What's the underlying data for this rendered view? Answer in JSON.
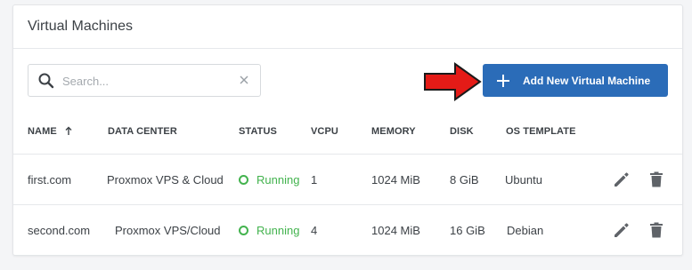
{
  "title": "Virtual Machines",
  "search": {
    "placeholder": "Search...",
    "value": ""
  },
  "add_button_label": "Add New Virtual Machine",
  "columns": [
    "NAME",
    "DATA CENTER",
    "STATUS",
    "VCPU",
    "MEMORY",
    "DISK",
    "OS TEMPLATE"
  ],
  "rows": [
    {
      "name": "first.com",
      "data_center": "Proxmox VPS & Cloud",
      "status": "Running",
      "vcpu": "1",
      "memory": "1024 MiB",
      "disk": "8 GiB",
      "os": "Ubuntu"
    },
    {
      "name": "second.com",
      "data_center": "Proxmox VPS/Cloud",
      "status": "Running",
      "vcpu": "4",
      "memory": "1024 MiB",
      "disk": "16 GiB",
      "os": "Debian"
    }
  ],
  "colors": {
    "accent": "#2b6cb8",
    "running": "#43b34e",
    "annotation_arrow": "#e41b17"
  }
}
